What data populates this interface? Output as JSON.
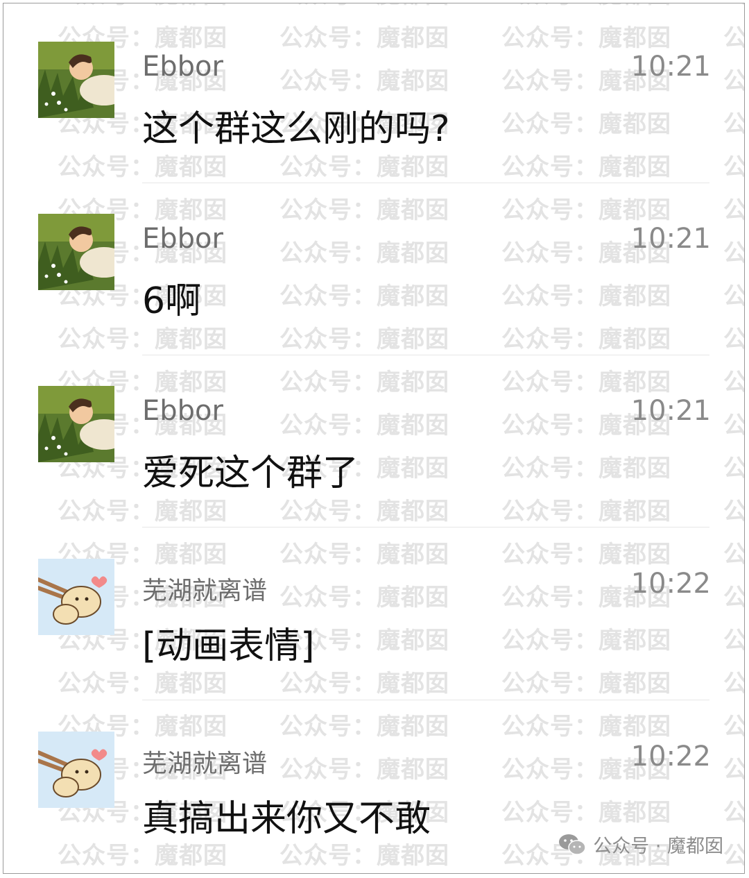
{
  "watermark": {
    "text": "公众号：魔都囡"
  },
  "messages": [
    {
      "sender": "Ebbor",
      "time": "10:21",
      "text": "这个群这么刚的吗?",
      "avatar": "man-in-grass-avatar"
    },
    {
      "sender": "Ebbor",
      "time": "10:21",
      "text": "6啊",
      "avatar": "man-in-grass-avatar"
    },
    {
      "sender": "Ebbor",
      "time": "10:21",
      "text": "爱死这个群了",
      "avatar": "man-in-grass-avatar"
    },
    {
      "sender": "芜湖就离谱",
      "time": "10:22",
      "text": "[动画表情]",
      "avatar": "puppy-with-chopsticks-avatar"
    },
    {
      "sender": "芜湖就离谱",
      "time": "10:22",
      "text": "真搞出来你又不敢",
      "avatar": "puppy-with-chopsticks-avatar"
    }
  ],
  "footer": {
    "label": "公众号 · 魔都囡",
    "icon": "wechat-icon"
  },
  "colors": {
    "name": "#6d6d6d",
    "time": "#8a8a8a",
    "text": "#111111",
    "watermark": "#e3e3e3",
    "separator": "#e6e6e6"
  }
}
